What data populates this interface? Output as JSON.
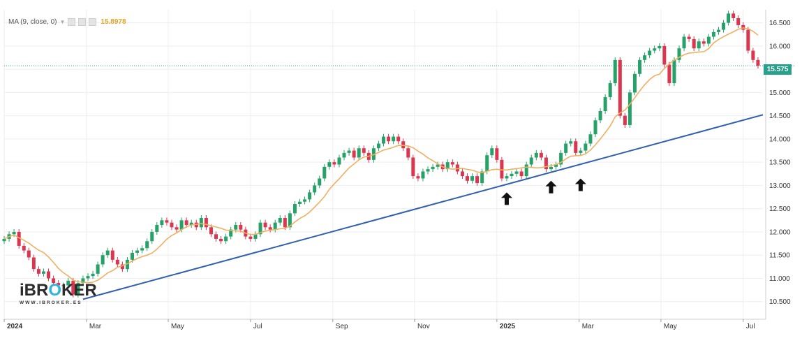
{
  "indicator": {
    "name": "MA (9, close, 0)",
    "value": "15.8978",
    "color": "#e8a020",
    "buttons": [
      "eye-icon",
      "gear-icon",
      "close-icon"
    ]
  },
  "logo": {
    "prefix": "iBR",
    "o": "O",
    "suffix": "KER",
    "subtitle": "WWW.IBROKER.ES"
  },
  "last_price": {
    "label": "15.575",
    "value": 15.575,
    "color": "#26a18b"
  },
  "chart_data": {
    "type": "candlestick",
    "x_axis": {
      "range": [
        2024.0,
        2025.54
      ],
      "labels": [
        "2024",
        "Mar",
        "May",
        "Jul",
        "Sep",
        "Nov",
        "2025",
        "Mar",
        "May",
        "Jul"
      ],
      "label_positions": [
        2024.0,
        2024.167,
        2024.333,
        2024.5,
        2024.667,
        2024.833,
        2025.0,
        2025.167,
        2025.333,
        2025.5
      ]
    },
    "y_axis": {
      "range": [
        10.12,
        16.78
      ],
      "position": "right",
      "ticks": [
        10.5,
        11.0,
        11.5,
        12.0,
        12.5,
        13.0,
        13.5,
        14.0,
        14.5,
        15.0,
        15.5,
        16.0,
        16.5
      ],
      "tick_labels": [
        "10.500",
        "11.000",
        "11.500",
        "12.000",
        "12.500",
        "13.000",
        "13.500",
        "14.000",
        "14.500",
        "15.000",
        "15.500",
        "16.000",
        "16.500"
      ]
    },
    "grid": true,
    "colors": {
      "up": "#26a269",
      "down": "#d9364f",
      "ma": "#f0b060",
      "trendline": "#2f5fb0"
    },
    "close": [
      {
        "x": 2024.0,
        "y": 11.85
      },
      {
        "x": 2024.01,
        "y": 11.95
      },
      {
        "x": 2024.02,
        "y": 12.0
      },
      {
        "x": 2024.03,
        "y": 11.7
      },
      {
        "x": 2024.04,
        "y": 11.6
      },
      {
        "x": 2024.05,
        "y": 11.45
      },
      {
        "x": 2024.06,
        "y": 11.2
      },
      {
        "x": 2024.07,
        "y": 11.1
      },
      {
        "x": 2024.08,
        "y": 11.15
      },
      {
        "x": 2024.09,
        "y": 11.0
      },
      {
        "x": 2024.1,
        "y": 10.9
      },
      {
        "x": 2024.11,
        "y": 10.85
      },
      {
        "x": 2024.12,
        "y": 10.85
      },
      {
        "x": 2024.13,
        "y": 10.95
      },
      {
        "x": 2024.14,
        "y": 10.65
      },
      {
        "x": 2024.15,
        "y": 10.9
      },
      {
        "x": 2024.16,
        "y": 11.0
      },
      {
        "x": 2024.17,
        "y": 11.05
      },
      {
        "x": 2024.18,
        "y": 11.1
      },
      {
        "x": 2024.19,
        "y": 11.3
      },
      {
        "x": 2024.2,
        "y": 11.5
      },
      {
        "x": 2024.21,
        "y": 11.6
      },
      {
        "x": 2024.22,
        "y": 11.4
      },
      {
        "x": 2024.23,
        "y": 11.3
      },
      {
        "x": 2024.24,
        "y": 11.2
      },
      {
        "x": 2024.25,
        "y": 11.4
      },
      {
        "x": 2024.26,
        "y": 11.55
      },
      {
        "x": 2024.27,
        "y": 11.6
      },
      {
        "x": 2024.28,
        "y": 11.65
      },
      {
        "x": 2024.29,
        "y": 11.8
      },
      {
        "x": 2024.3,
        "y": 12.0
      },
      {
        "x": 2024.31,
        "y": 12.15
      },
      {
        "x": 2024.32,
        "y": 12.25
      },
      {
        "x": 2024.33,
        "y": 12.2
      },
      {
        "x": 2024.34,
        "y": 12.1
      },
      {
        "x": 2024.35,
        "y": 12.05
      },
      {
        "x": 2024.36,
        "y": 12.25
      },
      {
        "x": 2024.37,
        "y": 12.15
      },
      {
        "x": 2024.38,
        "y": 12.2
      },
      {
        "x": 2024.39,
        "y": 12.1
      },
      {
        "x": 2024.4,
        "y": 12.3
      },
      {
        "x": 2024.41,
        "y": 12.1
      },
      {
        "x": 2024.42,
        "y": 11.95
      },
      {
        "x": 2024.43,
        "y": 11.85
      },
      {
        "x": 2024.44,
        "y": 11.8
      },
      {
        "x": 2024.45,
        "y": 11.9
      },
      {
        "x": 2024.46,
        "y": 12.05
      },
      {
        "x": 2024.47,
        "y": 12.15
      },
      {
        "x": 2024.48,
        "y": 12.05
      },
      {
        "x": 2024.49,
        "y": 11.9
      },
      {
        "x": 2024.5,
        "y": 11.85
      },
      {
        "x": 2024.51,
        "y": 11.95
      },
      {
        "x": 2024.52,
        "y": 12.2
      },
      {
        "x": 2024.53,
        "y": 12.1
      },
      {
        "x": 2024.54,
        "y": 12.05
      },
      {
        "x": 2024.55,
        "y": 12.2
      },
      {
        "x": 2024.56,
        "y": 12.3
      },
      {
        "x": 2024.57,
        "y": 12.1
      },
      {
        "x": 2024.58,
        "y": 12.4
      },
      {
        "x": 2024.59,
        "y": 12.6
      },
      {
        "x": 2024.6,
        "y": 12.65
      },
      {
        "x": 2024.61,
        "y": 12.7
      },
      {
        "x": 2024.62,
        "y": 12.85
      },
      {
        "x": 2024.63,
        "y": 13.0
      },
      {
        "x": 2024.64,
        "y": 13.15
      },
      {
        "x": 2024.65,
        "y": 13.4
      },
      {
        "x": 2024.66,
        "y": 13.5
      },
      {
        "x": 2024.67,
        "y": 13.45
      },
      {
        "x": 2024.68,
        "y": 13.6
      },
      {
        "x": 2024.69,
        "y": 13.7
      },
      {
        "x": 2024.7,
        "y": 13.75
      },
      {
        "x": 2024.71,
        "y": 13.6
      },
      {
        "x": 2024.72,
        "y": 13.8
      },
      {
        "x": 2024.73,
        "y": 13.7
      },
      {
        "x": 2024.74,
        "y": 13.55
      },
      {
        "x": 2024.75,
        "y": 13.8
      },
      {
        "x": 2024.76,
        "y": 13.9
      },
      {
        "x": 2024.77,
        "y": 14.05
      },
      {
        "x": 2024.78,
        "y": 13.95
      },
      {
        "x": 2024.79,
        "y": 14.05
      },
      {
        "x": 2024.8,
        "y": 13.95
      },
      {
        "x": 2024.81,
        "y": 13.8
      },
      {
        "x": 2024.82,
        "y": 13.6
      },
      {
        "x": 2024.83,
        "y": 13.2
      },
      {
        "x": 2024.84,
        "y": 13.15
      },
      {
        "x": 2024.85,
        "y": 13.3
      },
      {
        "x": 2024.86,
        "y": 13.35
      },
      {
        "x": 2024.87,
        "y": 13.4
      },
      {
        "x": 2024.88,
        "y": 13.45
      },
      {
        "x": 2024.89,
        "y": 13.35
      },
      {
        "x": 2024.9,
        "y": 13.5
      },
      {
        "x": 2024.91,
        "y": 13.45
      },
      {
        "x": 2024.92,
        "y": 13.3
      },
      {
        "x": 2024.93,
        "y": 13.2
      },
      {
        "x": 2024.94,
        "y": 13.1
      },
      {
        "x": 2024.95,
        "y": 13.2
      },
      {
        "x": 2024.96,
        "y": 13.05
      },
      {
        "x": 2024.97,
        "y": 13.3
      },
      {
        "x": 2024.98,
        "y": 13.65
      },
      {
        "x": 2024.99,
        "y": 13.8
      },
      {
        "x": 2025.0,
        "y": 13.55
      },
      {
        "x": 2025.01,
        "y": 13.15
      },
      {
        "x": 2025.02,
        "y": 13.2
      },
      {
        "x": 2025.03,
        "y": 13.25
      },
      {
        "x": 2025.04,
        "y": 13.3
      },
      {
        "x": 2025.05,
        "y": 13.2
      },
      {
        "x": 2025.06,
        "y": 13.45
      },
      {
        "x": 2025.07,
        "y": 13.6
      },
      {
        "x": 2025.08,
        "y": 13.7
      },
      {
        "x": 2025.09,
        "y": 13.6
      },
      {
        "x": 2025.1,
        "y": 13.35
      },
      {
        "x": 2025.11,
        "y": 13.4
      },
      {
        "x": 2025.12,
        "y": 13.45
      },
      {
        "x": 2025.13,
        "y": 13.7
      },
      {
        "x": 2025.14,
        "y": 13.9
      },
      {
        "x": 2025.15,
        "y": 13.95
      },
      {
        "x": 2025.16,
        "y": 13.7
      },
      {
        "x": 2025.17,
        "y": 13.75
      },
      {
        "x": 2025.18,
        "y": 13.9
      },
      {
        "x": 2025.19,
        "y": 14.1
      },
      {
        "x": 2025.2,
        "y": 14.4
      },
      {
        "x": 2025.21,
        "y": 14.6
      },
      {
        "x": 2025.22,
        "y": 14.9
      },
      {
        "x": 2025.23,
        "y": 15.2
      },
      {
        "x": 2025.24,
        "y": 15.7
      },
      {
        "x": 2025.25,
        "y": 14.5
      },
      {
        "x": 2025.26,
        "y": 14.3
      },
      {
        "x": 2025.27,
        "y": 15.0
      },
      {
        "x": 2025.28,
        "y": 15.4
      },
      {
        "x": 2025.29,
        "y": 15.7
      },
      {
        "x": 2025.3,
        "y": 15.8
      },
      {
        "x": 2025.31,
        "y": 15.9
      },
      {
        "x": 2025.32,
        "y": 15.95
      },
      {
        "x": 2025.33,
        "y": 16.0
      },
      {
        "x": 2025.34,
        "y": 15.6
      },
      {
        "x": 2025.35,
        "y": 15.2
      },
      {
        "x": 2025.36,
        "y": 15.7
      },
      {
        "x": 2025.37,
        "y": 15.95
      },
      {
        "x": 2025.38,
        "y": 16.2
      },
      {
        "x": 2025.39,
        "y": 16.15
      },
      {
        "x": 2025.4,
        "y": 15.95
      },
      {
        "x": 2025.41,
        "y": 16.1
      },
      {
        "x": 2025.42,
        "y": 16.05
      },
      {
        "x": 2025.43,
        "y": 16.2
      },
      {
        "x": 2025.44,
        "y": 16.3
      },
      {
        "x": 2025.45,
        "y": 16.35
      },
      {
        "x": 2025.46,
        "y": 16.5
      },
      {
        "x": 2025.47,
        "y": 16.7
      },
      {
        "x": 2025.48,
        "y": 16.6
      },
      {
        "x": 2025.49,
        "y": 16.45
      },
      {
        "x": 2025.5,
        "y": 16.35
      },
      {
        "x": 2025.51,
        "y": 15.9
      },
      {
        "x": 2025.52,
        "y": 15.7
      },
      {
        "x": 2025.53,
        "y": 15.575
      }
    ],
    "trendline": [
      {
        "x": 2024.16,
        "y": 10.55
      },
      {
        "x": 2025.54,
        "y": 14.52
      }
    ],
    "ma_period": 9,
    "annotations": [
      {
        "type": "arrow-up",
        "x": 2025.02,
        "y": 12.85
      },
      {
        "type": "arrow-up",
        "x": 2025.11,
        "y": 13.1
      },
      {
        "type": "arrow-up",
        "x": 2025.17,
        "y": 13.15
      }
    ]
  }
}
